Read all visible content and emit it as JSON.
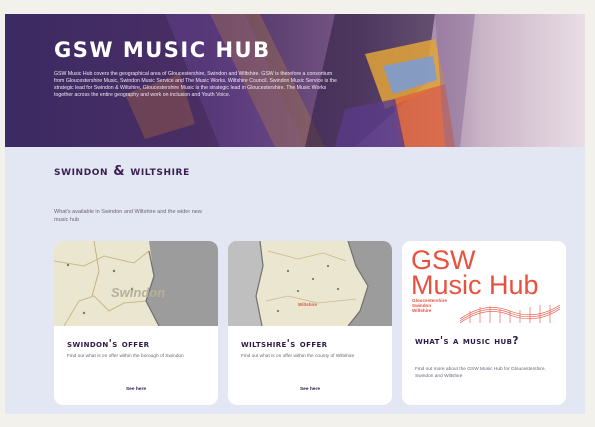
{
  "hero": {
    "title": "GSW MUSIC HUB",
    "description": "GSW Music Hub covers the geographical area of Gloucestershire, Swindon and Wiltshire. GSW is therefore a consortium from Gloucestershire Music, Swindon Music Service and The Music Works. Wiltshire Council. Swindon Music Service is the strategic lead for Swindon & Wiltshire, Gloucestershire Music is the strategic lead in Gloucestershire. The Music Works together across the entire geography and work on inclusion and Youth Voice."
  },
  "section": {
    "title": "Swindon & Wiltshire",
    "description": "What's available in Swindon and Wiltshire and the wider new music hub"
  },
  "cards": [
    {
      "title": "Swindon's Offer",
      "description": "Find out what is on offer within the borough of Swindon",
      "link": "See here",
      "map_label": "Swindon"
    },
    {
      "title": "Wiltshire's Offer",
      "description": "Find out what is on offer within the county of Wiltshire",
      "link": "See here",
      "map_label": "Wiltshire"
    },
    {
      "title": "What's a Music Hub?",
      "description": "Find out more about the GSW Music Hub for Gloucestershire, Swindon and Wiltshire",
      "link": "",
      "logo": {
        "line1": "GSW",
        "line2": "Music Hub",
        "sub1": "Gloucestershire",
        "sub2": "Swindon",
        "sub3": "Wiltshire"
      }
    }
  ],
  "colors": {
    "hero_purple": "#3c2a63",
    "page_bg": "#e3e6f3",
    "title_dark": "#2d1a44",
    "logo_red": "#e8503f"
  }
}
